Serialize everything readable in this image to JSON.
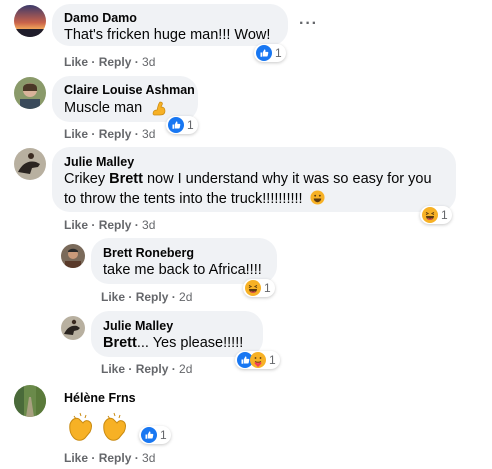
{
  "comments": [
    {
      "name": "Damo Damo",
      "text": "That's fricken huge man!!! Wow!",
      "reactions": "1",
      "like": "Like",
      "reply": "Reply",
      "time": "3d",
      "reaction_icon": "like-icon"
    },
    {
      "name": "Claire Louise Ashman",
      "text": "Muscle man",
      "reactions": "1",
      "like": "Like",
      "reply": "Reply",
      "time": "3d",
      "reaction_icon": "like-icon",
      "emoji": "flexed-biceps-icon"
    },
    {
      "name": "Julie Malley",
      "text_pre": "Crikey ",
      "mention": "Brett",
      "text_post": " now I understand why it was so easy for you",
      "text_line2": "to throw the tents into the truck!!!!!!!!!!",
      "reactions": "1",
      "like": "Like",
      "reply": "Reply",
      "time": "3d",
      "reaction_icon": "haha-icon",
      "emoji": "grinning-face-icon"
    },
    {
      "name": "Brett Roneberg",
      "text": "take me back to Africa!!!!",
      "reactions": "1",
      "like": "Like",
      "reply": "Reply",
      "time": "2d",
      "reaction_icon": "haha-icon"
    },
    {
      "name": "Julie Malley",
      "mention": "Brett",
      "text_post": "... Yes please!!!!!",
      "reactions": "1",
      "like": "Like",
      "reply": "Reply",
      "time": "2d",
      "reaction_icon": "like-icon",
      "reaction_icon_2": "care-icon"
    },
    {
      "name": "Hélène Frns",
      "reactions": "1",
      "like": "Like",
      "reply": "Reply",
      "time": "3d",
      "reaction_icon": "like-icon",
      "emoji": "clapping-hands-icon"
    }
  ],
  "colors": {
    "bubble": "#f0f2f5",
    "meta": "#65676b",
    "like_blue": "#1877f2",
    "haha_yellow": "#f7b125"
  }
}
